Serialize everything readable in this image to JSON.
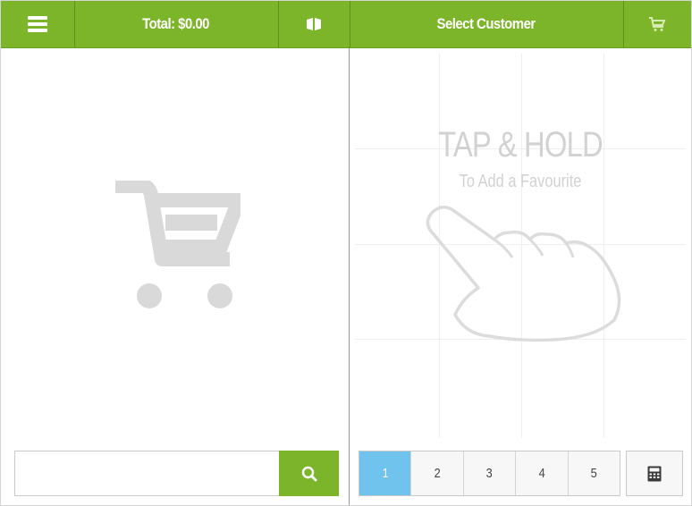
{
  "header": {
    "menu_icon": "hamburger-menu-icon",
    "total_label": "Total: $0.00",
    "drawer_icon": "cash-drawer-icon",
    "customer_label": "Select Customer",
    "cart_icon": "shopping-cart-icon"
  },
  "cart": {
    "empty_icon": "shopping-cart-icon"
  },
  "search": {
    "value": "",
    "placeholder": "",
    "button_icon": "search-icon"
  },
  "favourites": {
    "hint_title": "TAP & HOLD",
    "hint_subtitle": "To Add a Favourite",
    "hint_icon": "pointing-hand-icon"
  },
  "pager": {
    "pages": [
      "1",
      "2",
      "3",
      "4",
      "5"
    ],
    "active_page": "1"
  },
  "calculator": {
    "icon": "calculator-icon"
  },
  "colors": {
    "accent_green": "#7cb529",
    "active_page_blue": "#6fc3ec",
    "placeholder_gray": "#d2d2d2"
  }
}
